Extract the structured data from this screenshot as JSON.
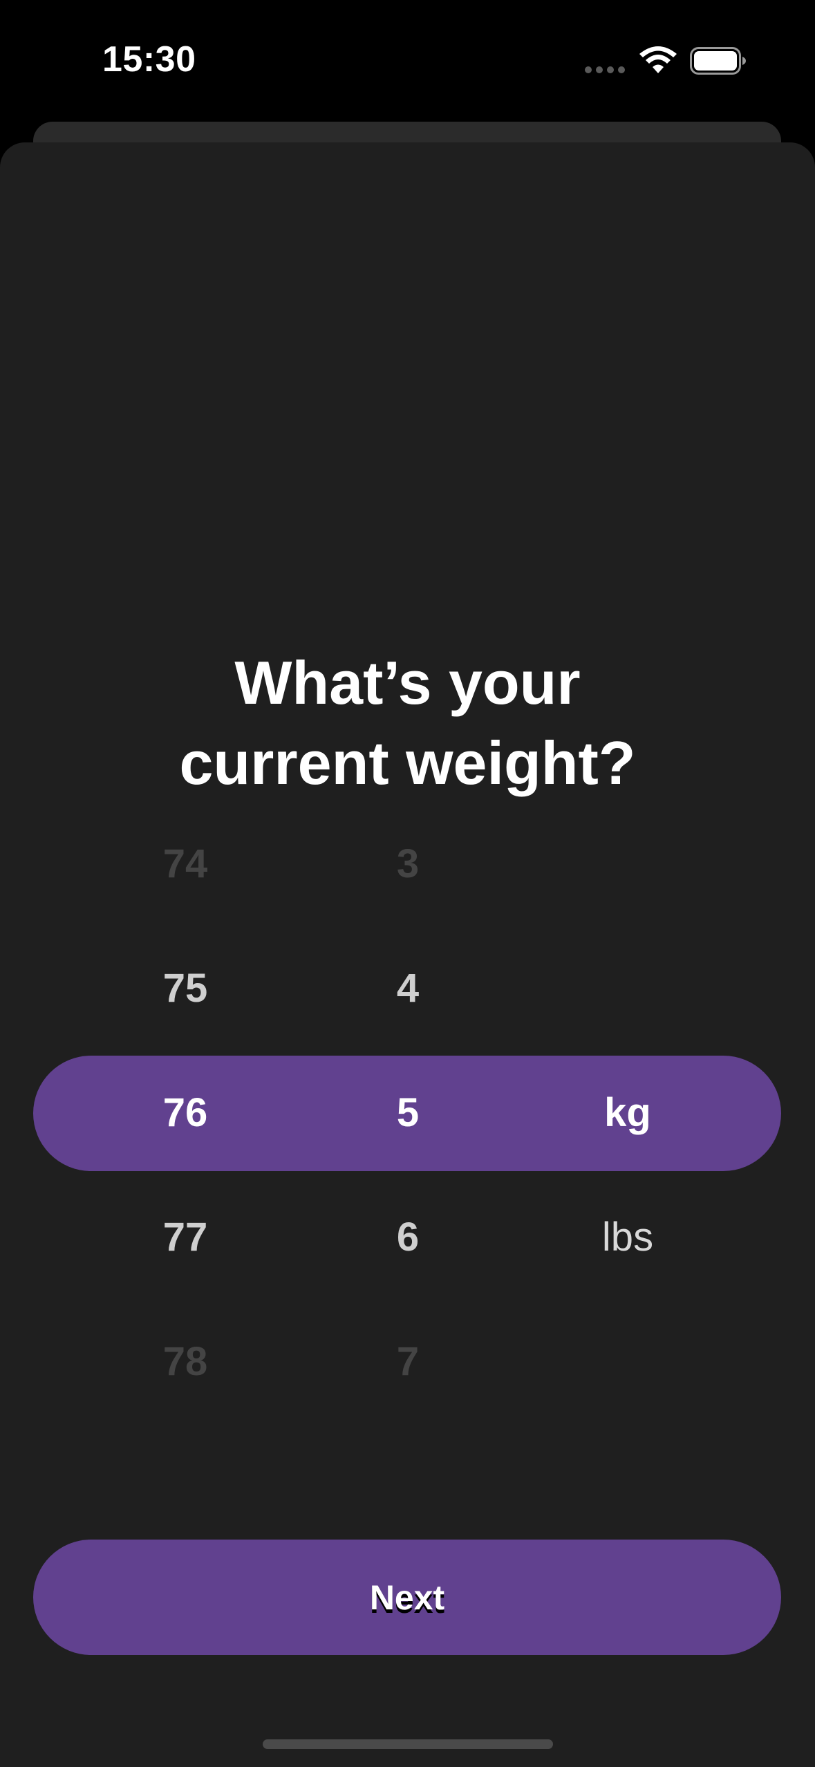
{
  "status_bar": {
    "time": "15:30",
    "icons": [
      "cellular-signal-icon",
      "wifi-icon",
      "battery-icon"
    ]
  },
  "title": {
    "line1": "What’s your",
    "line2": "current weight?"
  },
  "picker": {
    "whole": {
      "values": [
        "74",
        "75",
        "76",
        "77",
        "78"
      ],
      "selected": "76"
    },
    "decimal": {
      "values": [
        "3",
        "4",
        "5",
        "6",
        "7"
      ],
      "selected": "5"
    },
    "unit": {
      "values": [
        "kg",
        "lbs"
      ],
      "selected": "kg"
    }
  },
  "next_button": {
    "label": "Next"
  },
  "colors": {
    "accent": "#61418f",
    "sheet_background": "#1f1f1f",
    "page_background": "#000000"
  }
}
